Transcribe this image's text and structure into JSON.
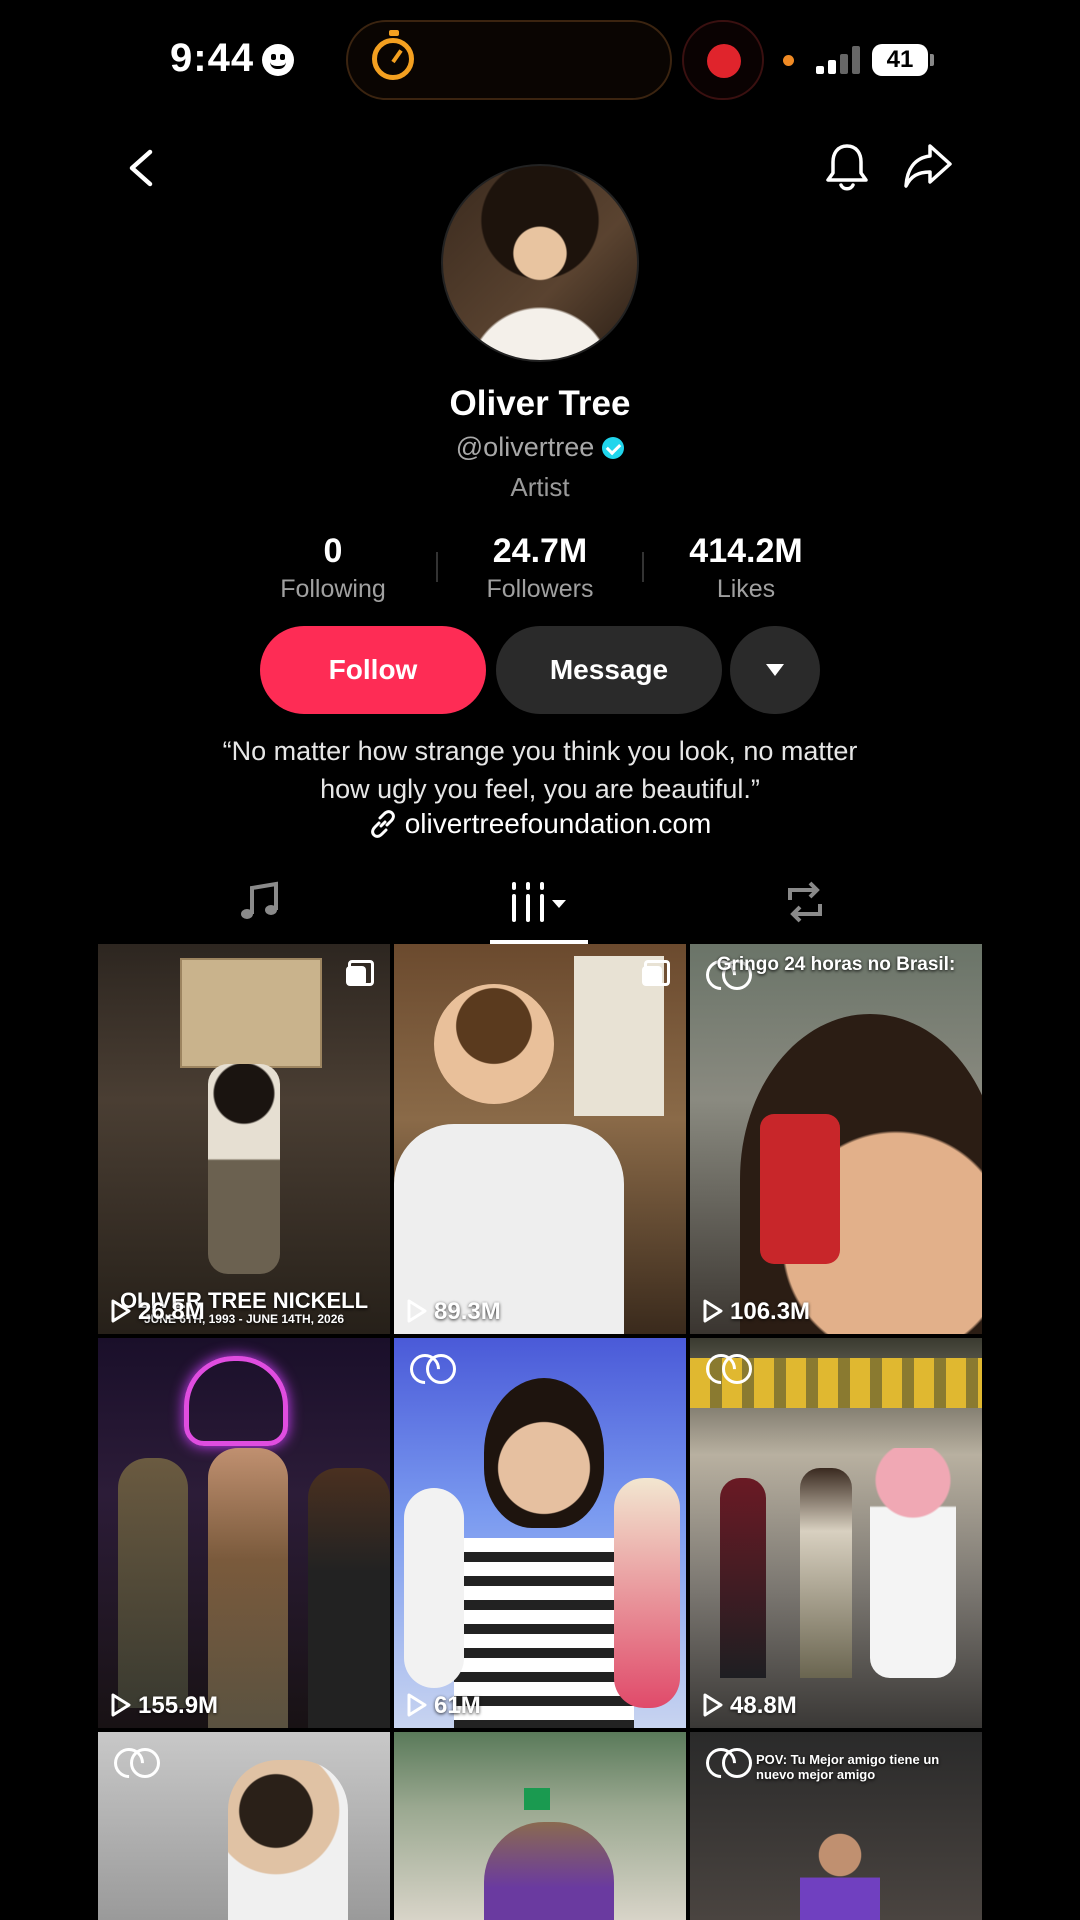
{
  "status_bar": {
    "time": "9:44",
    "battery": "41"
  },
  "profile": {
    "name": "Oliver Tree",
    "handle": "@olivertree",
    "category": "Artist",
    "stats": [
      {
        "value": "0",
        "label": "Following"
      },
      {
        "value": "24.7M",
        "label": "Followers"
      },
      {
        "value": "414.2M",
        "label": "Likes"
      }
    ],
    "follow_label": "Follow",
    "message_label": "Message",
    "bio_line1": "“No matter how strange you think you look, no matter",
    "bio_line2": "how ugly you feel, you are beautiful.”",
    "link": "olivertreefoundation.com"
  },
  "colors": {
    "accent": "#fe2c55",
    "verified": "#20d5ec"
  },
  "videos": [
    {
      "views": "26.8M",
      "overlay": "OLIVER TREE NICKELL",
      "overlay2": "JUNE 6TH, 1993 - JUNE 14TH, 2026",
      "badge": "multi"
    },
    {
      "views": "89.3M",
      "badge": "multi"
    },
    {
      "views": "106.3M",
      "overlay": "Gringo 24 horas no Brasil:",
      "badge": "collab"
    },
    {
      "views": "155.9M"
    },
    {
      "views": "61M",
      "badge": "collab"
    },
    {
      "views": "48.8M",
      "badge": "collab"
    },
    {
      "views": "",
      "badge": "collab"
    },
    {
      "views": ""
    },
    {
      "views": "",
      "overlay": "POV: Tu Mejor amigo tiene un nuevo mejor amigo",
      "badge": "collab"
    }
  ]
}
